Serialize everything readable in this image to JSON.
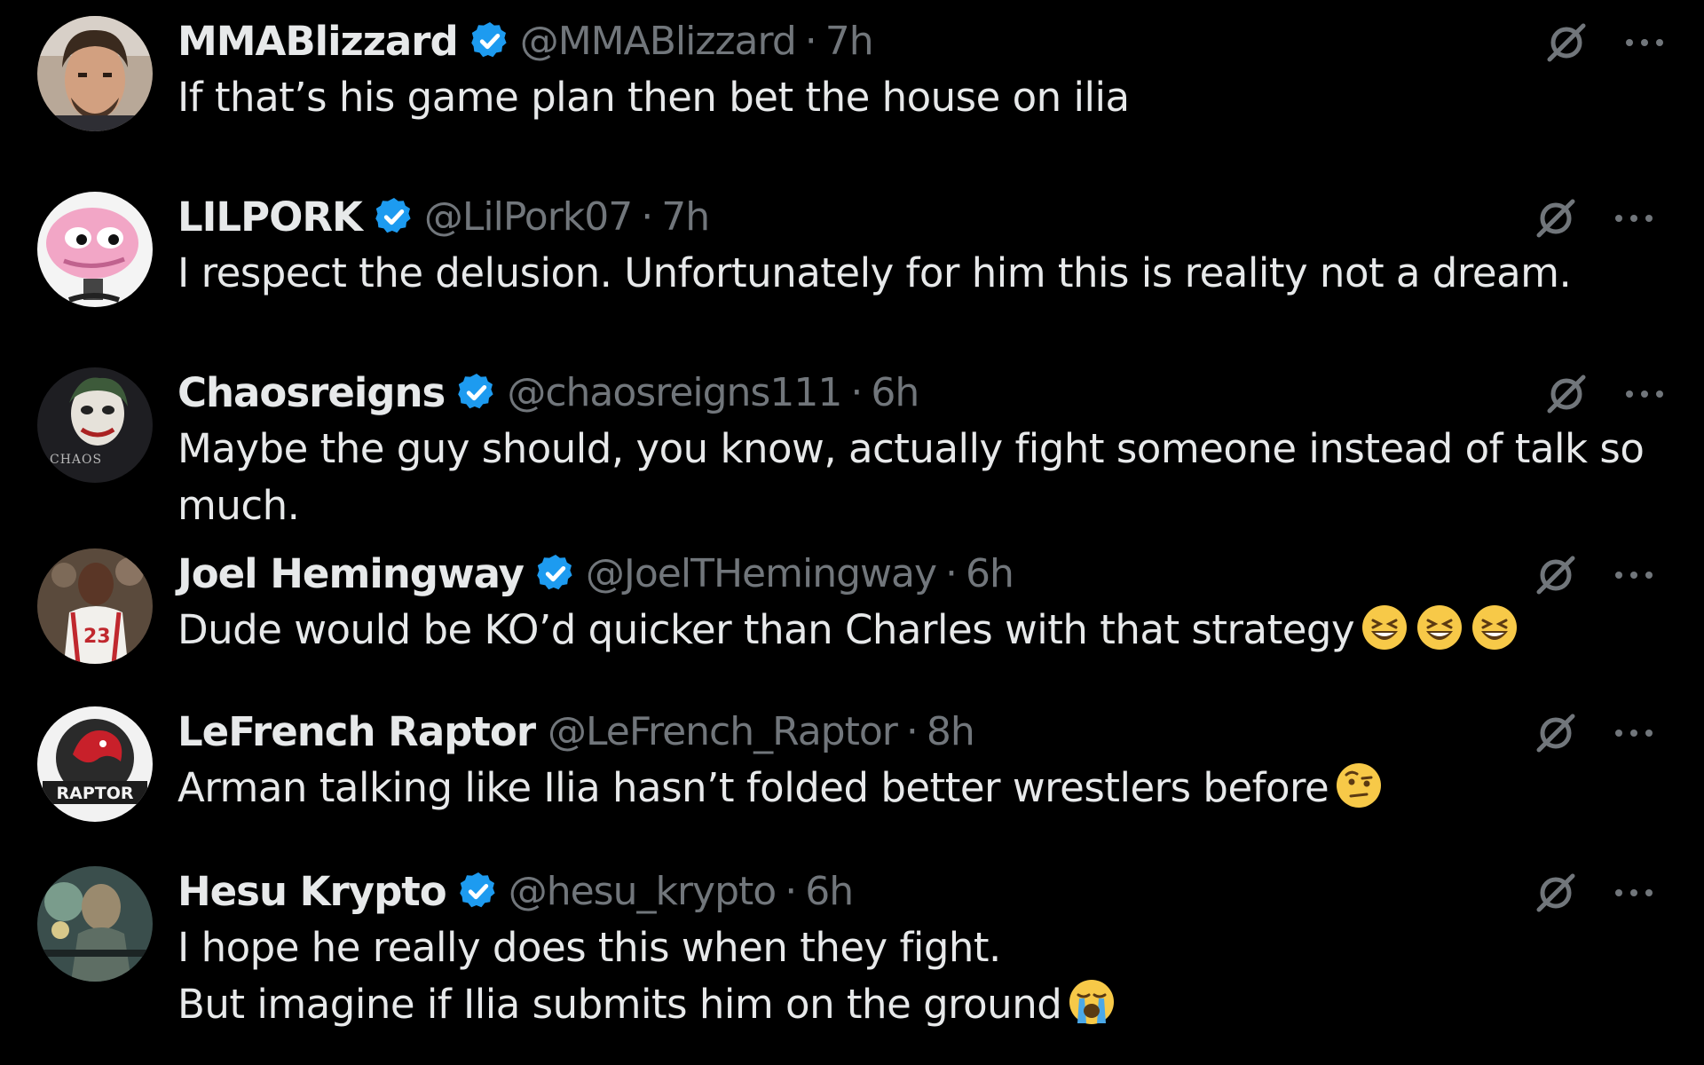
{
  "replies": [
    {
      "name": "MMABlizzard",
      "verified": true,
      "handle": "@MMABlizzard",
      "separator": "·",
      "time": "7h",
      "lines": [
        "If that’s his game plan then bet the house on ilia"
      ],
      "emoji": []
    },
    {
      "name": "LILPORK",
      "verified": true,
      "handle": "@LilPork07",
      "separator": "·",
      "time": "7h",
      "lines": [
        "I respect the delusion. Unfortunately for him this is reality not a dream."
      ],
      "emoji": []
    },
    {
      "name": "Chaosreigns",
      "verified": true,
      "handle": "@chaosreigns111",
      "separator": "·",
      "time": "6h",
      "lines": [
        "Maybe the guy should, you know, actually fight someone instead of talk so",
        "much."
      ],
      "emoji": [],
      "avatar_text": "CHAOS"
    },
    {
      "name": "Joel Hemingway",
      "verified": true,
      "handle": "@JoelTHemingway",
      "separator": "·",
      "time": "6h",
      "lines": [
        "Dude would be KO’d quicker than Charles with that strategy"
      ],
      "emoji": [
        "grinning-squinting-face",
        "grinning-squinting-face",
        "grinning-squinting-face"
      ],
      "avatar_text": "23"
    },
    {
      "name": "LeFrench Raptor",
      "verified": false,
      "handle": "@LeFrench_Raptor",
      "separator": "·",
      "time": "8h",
      "lines": [
        "Arman talking like Ilia hasn’t folded better wrestlers before"
      ],
      "emoji": [
        "face-with-raised-eyebrow"
      ],
      "avatar_text": "RAPTOR"
    },
    {
      "name": "Hesu Krypto",
      "verified": true,
      "handle": "@hesu_krypto",
      "separator": "·",
      "time": "6h",
      "lines": [
        "I hope he really does this when they fight.",
        "But imagine if Ilia submits him on the ground"
      ],
      "emoji": [
        "loudly-crying-face"
      ]
    }
  ],
  "icons": {
    "verified": "verified-badge-icon",
    "grok": "grok-icon",
    "more": "more-icon"
  },
  "colors": {
    "background": "#000000",
    "text": "#e7e9ea",
    "secondary": "#71767b",
    "verified": "#1d9bf0"
  }
}
